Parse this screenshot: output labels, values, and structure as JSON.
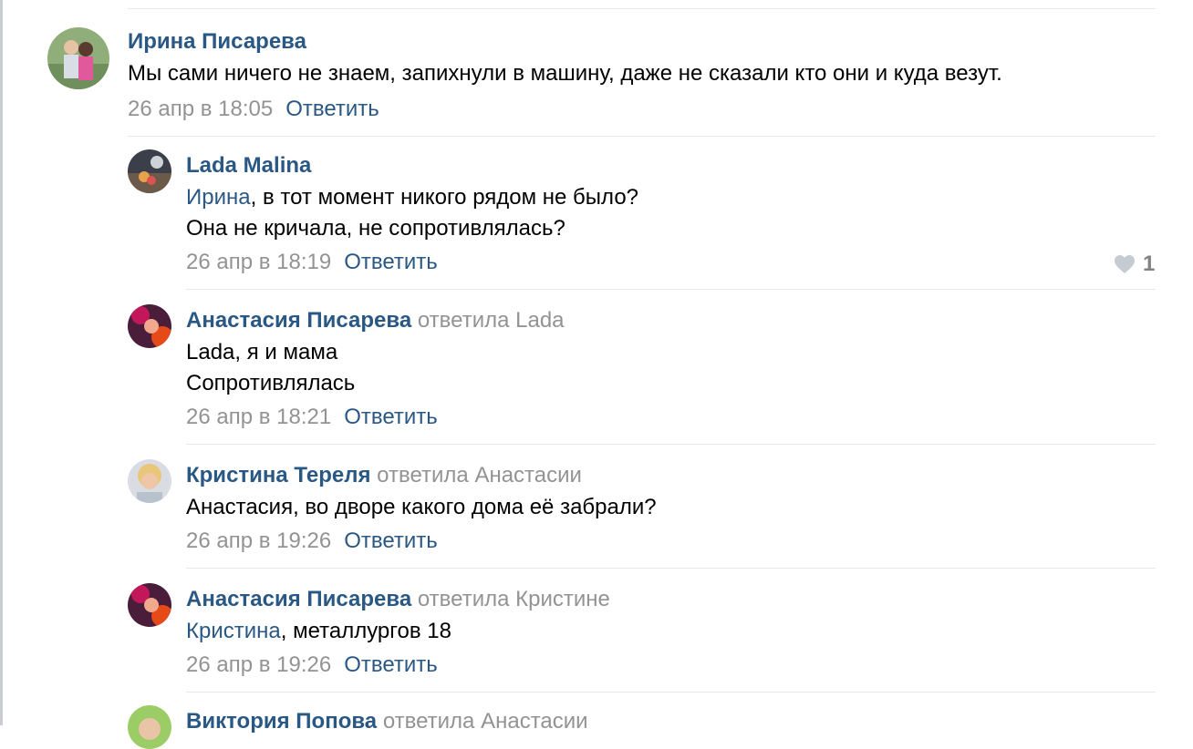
{
  "comments": [
    {
      "author": "Ирина Писарева",
      "reply_to": "",
      "mention": "",
      "lines": [
        "Мы сами ничего не знаем, запихнули в машину, даже не сказали кто они и куда везут."
      ],
      "date": "26 апр в 18:05",
      "reply_label": "Ответить"
    },
    {
      "author": "Lada Malina",
      "reply_to": "",
      "mention": "Ирина",
      "lines": [
        ", в тот момент никого рядом не было?",
        "Она не кричала, не сопротивлялась?"
      ],
      "date": "26 апр в 18:19",
      "reply_label": "Ответить",
      "likes": "1"
    },
    {
      "author": "Анастасия Писарева",
      "reply_to": "ответила",
      "reply_to_name": "Lada",
      "mention": "",
      "lines": [
        "Lada, я и мама",
        "Сопротивлялась"
      ],
      "date": "26 апр в 18:21",
      "reply_label": "Ответить"
    },
    {
      "author": "Кристина Тереля",
      "reply_to": "ответила",
      "reply_to_name": "Анастасии",
      "mention": "",
      "lines": [
        "Анастасия, во дворе какого дома её забрали?"
      ],
      "date": "26 апр в 19:26",
      "reply_label": "Ответить"
    },
    {
      "author": "Анастасия Писарева",
      "reply_to": "ответила",
      "reply_to_name": "Кристине",
      "mention": "Кристина",
      "lines": [
        ", металлургов 18"
      ],
      "date": "26 апр в 19:26",
      "reply_label": "Ответить"
    },
    {
      "author": "Виктория Попова",
      "reply_to": "ответила",
      "reply_to_name": "Анастасии"
    }
  ],
  "icons": {
    "like": "heart-icon"
  },
  "colors": {
    "link": "#2a5885",
    "muted": "#939393",
    "separator": "#e7e8ec"
  }
}
